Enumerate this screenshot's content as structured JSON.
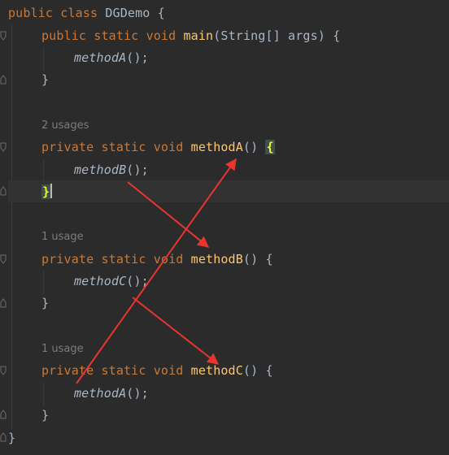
{
  "code": {
    "class_line": {
      "kw1": "public",
      "kw2": "class",
      "name": "DGDemo",
      "open": "{"
    },
    "main": {
      "kw1": "public",
      "kw2": "static",
      "kw3": "void",
      "name": "main",
      "params": "(String[] args) {",
      "call": "methodA",
      "call_suffix": "();",
      "close": "}"
    },
    "methodA": {
      "usages": "2 usages",
      "kw1": "private",
      "kw2": "static",
      "kw3": "void",
      "name": "methodA",
      "parens": "()",
      "open": "{",
      "call": "methodB",
      "call_suffix": "();",
      "close": "}"
    },
    "methodB": {
      "usages": "1 usage",
      "kw1": "private",
      "kw2": "static",
      "kw3": "void",
      "name": "methodB",
      "parens": "()",
      "open": "{",
      "call": "methodC",
      "call_suffix": "();",
      "close": "}"
    },
    "methodC": {
      "usages": "1 usage",
      "kw1": "private",
      "kw2": "static",
      "kw3": "void",
      "name": "methodC",
      "parens": "()",
      "open": "{",
      "call": "methodA",
      "call_suffix": "();",
      "close": "}"
    },
    "class_close": "}"
  },
  "colors": {
    "background": "#2b2b2b",
    "keyword": "#cc7832",
    "method_name": "#ffc66d",
    "plain_text": "#a9b7c6",
    "usage_hint": "#7c7c7c",
    "annotation_arrow": "#e8352f",
    "brace_match_bg": "#3b514d",
    "brace_match_fg": "#ffef28"
  },
  "annotations": {
    "arrow_count": 4,
    "description_icons": [
      "arrow-icon"
    ]
  }
}
